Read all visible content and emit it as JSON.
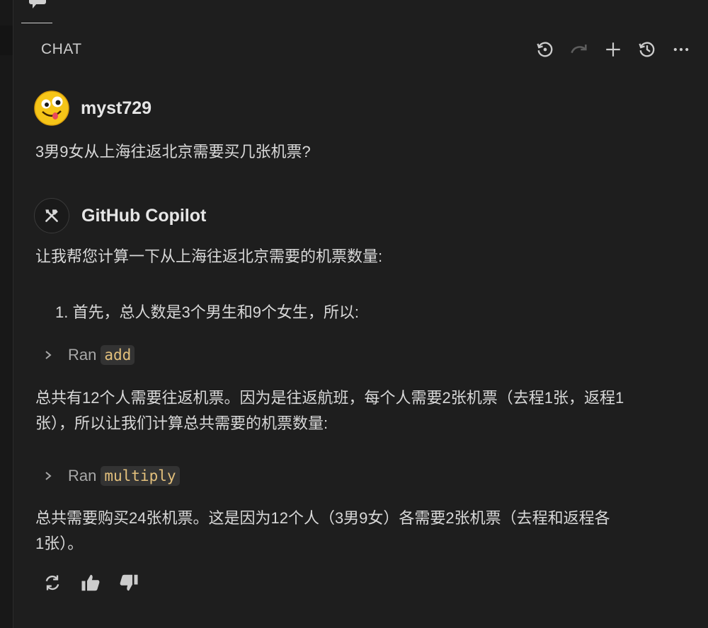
{
  "header": {
    "title": "CHAT"
  },
  "user_message": {
    "author": "myst729",
    "text": "3男9女从上海往返北京需要买几张机票?"
  },
  "assistant_message": {
    "author": "GitHub Copilot",
    "intro": "让我帮您计算一下从上海往返北京需要的机票数量:",
    "list_item": "1. 首先，总人数是3个男生和9个女生，所以:",
    "tool_call_1": {
      "prefix": "Ran",
      "name": "add"
    },
    "paragraph_1": [
      "总共有12个人需要往返机票。因为是往返航班，每个人需要2张机票（去程1张，返程1",
      "张），所以让我们计算总共需要的机票数量:"
    ],
    "tool_call_2": {
      "prefix": "Ran",
      "name": "multiply"
    },
    "paragraph_2": [
      "总共需要购买24张机票。这是因为12个人（3男9女）各需要2张机票（去程和返程各",
      "1张）。"
    ]
  },
  "icons": {
    "header": [
      "restart-icon",
      "redo-icon",
      "plus-icon",
      "history-icon",
      "more-icon"
    ],
    "feedback": [
      "refresh-icon",
      "thumbs-up-icon",
      "thumbs-down-icon"
    ]
  },
  "colors": {
    "background": "#1e1e1e",
    "code_text": "#e3c07c",
    "code_bg": "#333333"
  }
}
